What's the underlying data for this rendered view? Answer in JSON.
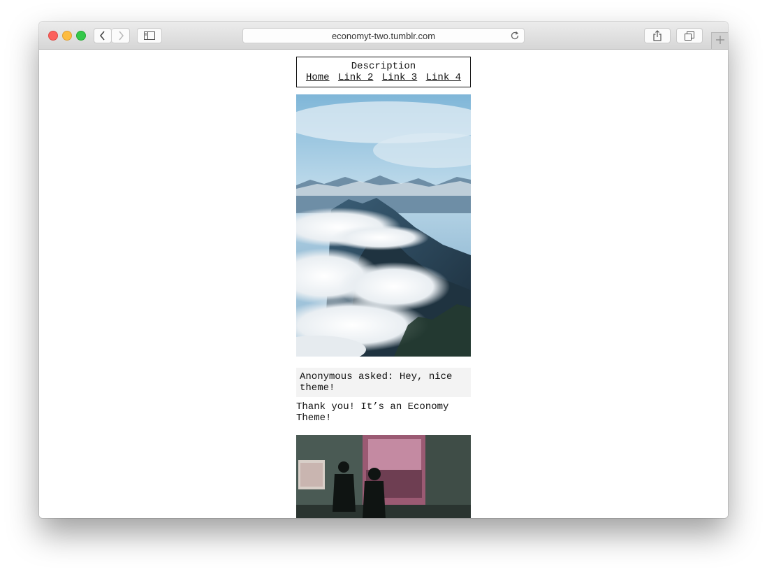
{
  "browser": {
    "url": "economyt-two.tumblr.com"
  },
  "blog": {
    "description": "Description",
    "nav": [
      "Home",
      "Link 2",
      "Link 3",
      "Link 4"
    ]
  },
  "posts": {
    "ask_question": "Anonymous asked: Hey, nice theme!",
    "ask_answer": "Thank you! It’s an Economy Theme!"
  },
  "icons": {
    "back": "chevron-left-icon",
    "forward": "chevron-right-icon",
    "sidebar": "sidebar-icon",
    "reload": "reload-icon",
    "share": "share-icon",
    "tabs": "tabs-icon",
    "new_tab": "plus-icon"
  },
  "colors": {
    "close": "#fc605c",
    "minimize": "#fdbc40",
    "zoom": "#34c84a"
  }
}
